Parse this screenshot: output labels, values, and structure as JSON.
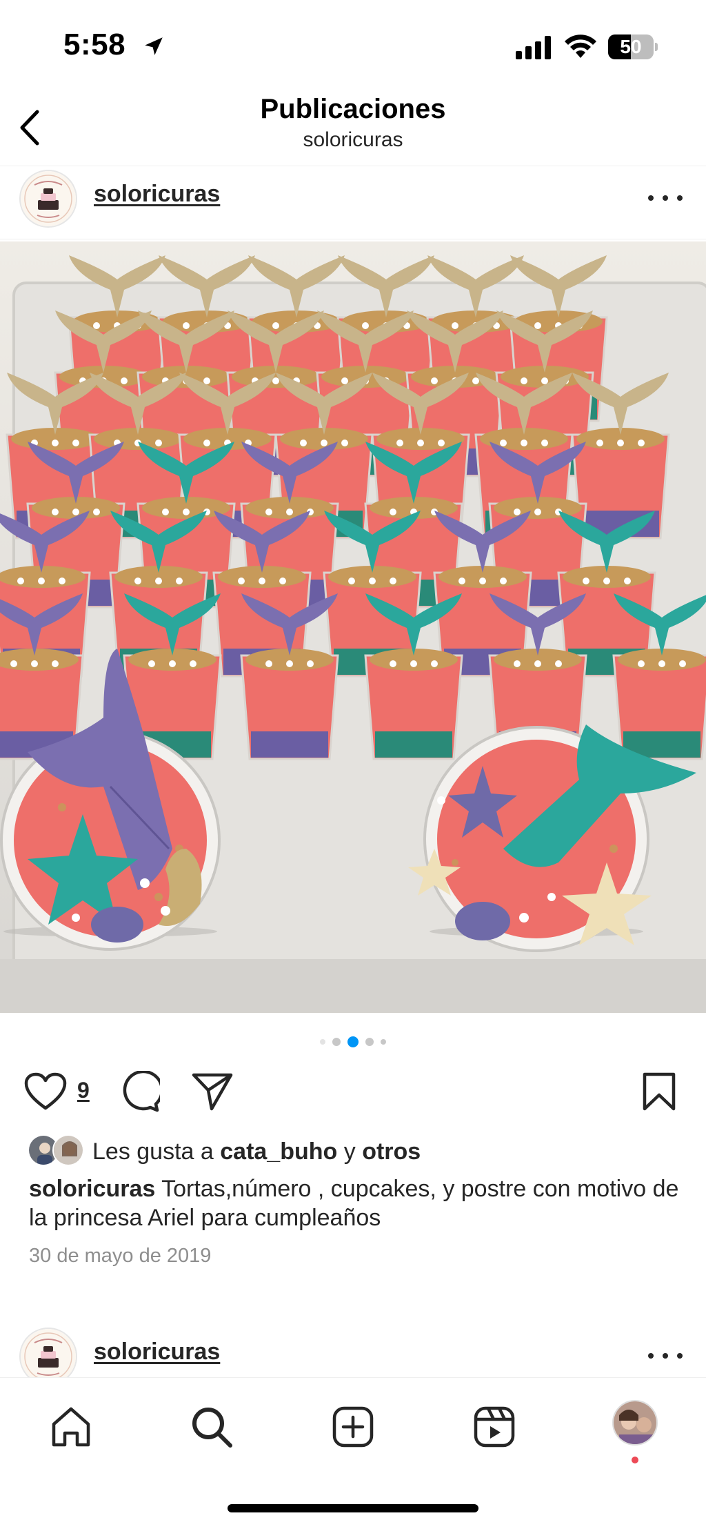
{
  "status_bar": {
    "time": "5:58",
    "battery": "50",
    "battery_level": 0.5,
    "icons": [
      "location-arrow-icon",
      "cellular-signal-icon",
      "wifi-icon",
      "battery-icon"
    ]
  },
  "header": {
    "title": "Publicaciones",
    "subtitle": "soloricuras",
    "back_icon": "chevron-left-icon"
  },
  "post": {
    "username": "soloricuras",
    "more_icon": "ellipsis-icon",
    "image_icon": "photo-mermaid-dessert-cups",
    "pager": {
      "count": 5,
      "active_index": 2
    },
    "like_count": "9",
    "liked_by": {
      "prefix": "Les gusta a ",
      "user": "cata_buho",
      "middle": " y ",
      "others": "otros"
    },
    "caption": {
      "username": "soloricuras",
      "text": " Tortas,número , cupcakes, y postre con motivo de la princesa Ariel para cumpleaños"
    },
    "date": "30 de mayo de 2019",
    "action_icons": [
      "heart-icon",
      "comment-icon",
      "share-icon",
      "bookmark-icon"
    ]
  },
  "next_post": {
    "username": "soloricuras"
  },
  "tab_bar": {
    "items": [
      "home-icon",
      "search-icon",
      "create-icon",
      "reels-icon",
      "profile-avatar"
    ],
    "accent_color": "#ed4956"
  },
  "colors": {
    "text": "#262626",
    "muted": "#8e8e8e",
    "pager_active": "#0095f6",
    "pager_inactive": "#c7c7c7"
  }
}
